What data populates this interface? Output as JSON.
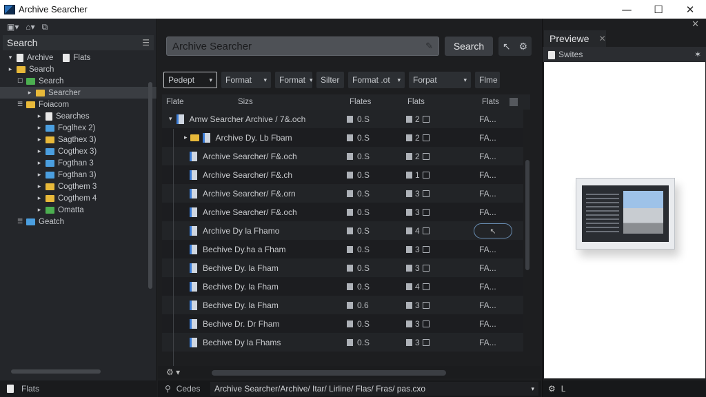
{
  "window": {
    "title": "Archive Searcher",
    "controls": {
      "minimize": "—",
      "maximize": "☐",
      "close": "✕"
    }
  },
  "sidebar": {
    "toolbar_icons": [
      "new-file-icon",
      "build-icon",
      "copy-icon"
    ],
    "search_label": "Search",
    "menu_glyph": "☰",
    "tree": [
      {
        "label": "Archive",
        "extra": "Flats",
        "indent": 0,
        "toggle": "▾",
        "icon": "doc"
      },
      {
        "label": "Search",
        "indent": 0,
        "toggle": "▸",
        "icon": "yellow"
      },
      {
        "label": "Search",
        "indent": 1,
        "toggle": "☐",
        "icon": "green"
      },
      {
        "label": "Searcher",
        "indent": 2,
        "toggle": "▸",
        "icon": "yellow",
        "selected": true
      },
      {
        "label": "Foiacom",
        "indent": 1,
        "toggle": "☰",
        "icon": "yellow"
      },
      {
        "label": "Searches",
        "indent": 3,
        "toggle": "▸",
        "icon": "doc"
      },
      {
        "label": "Foglhex 2)",
        "indent": 3,
        "toggle": "▸",
        "icon": "blue"
      },
      {
        "label": "Sagthex 3)",
        "indent": 3,
        "toggle": "▸",
        "icon": "yellow"
      },
      {
        "label": "Cogthex 3)",
        "indent": 3,
        "toggle": "▸",
        "icon": "blue"
      },
      {
        "label": "Fogthan 3",
        "indent": 3,
        "toggle": "▸",
        "icon": "blue"
      },
      {
        "label": "Fogthan 3)",
        "indent": 3,
        "toggle": "▸",
        "icon": "blue"
      },
      {
        "label": "Cogthem 3",
        "indent": 3,
        "toggle": "▸",
        "icon": "yellow"
      },
      {
        "label": "Cogthem 4",
        "indent": 3,
        "toggle": "▸",
        "icon": "yellow"
      },
      {
        "label": "Omatta",
        "indent": 3,
        "toggle": "▸",
        "icon": "green"
      },
      {
        "label": "Geatch",
        "indent": 1,
        "toggle": "☰",
        "icon": "blue"
      }
    ],
    "status": "Flats"
  },
  "main": {
    "search_value": "Archive Searcher",
    "search_button": "Search",
    "filters": [
      {
        "label": "Pedept",
        "caret": "▾"
      },
      {
        "label": "Format",
        "caret": "▾"
      },
      {
        "label": "Format",
        "caret": "▾"
      },
      {
        "label": "Silter",
        "caret": ""
      },
      {
        "label": "Format .ot",
        "caret": "▾"
      },
      {
        "label": "Forpat",
        "caret": "▾"
      },
      {
        "label": "Flme",
        "caret": ""
      }
    ],
    "columns": [
      "Flate",
      "Sizs",
      "Flates",
      "Flats",
      "Flats"
    ],
    "rows": [
      {
        "name": "Amw Searcher Archive / 7&.och",
        "size": "0.S",
        "flag": "2",
        "fl": "FA..."
      },
      {
        "name": "Archive Dy. Lb Fbam",
        "size": "0.S",
        "flag": "2",
        "fl": "FA..."
      },
      {
        "name": "Archive Searcher/ F&.och",
        "size": "0.S",
        "flag": "2",
        "fl": "FA..."
      },
      {
        "name": "Archive Searcher/ F&.ch",
        "size": "0.S",
        "flag": "1",
        "fl": "FA..."
      },
      {
        "name": "Archive Searcher/ F&.orn",
        "size": "0.S",
        "flag": "3",
        "fl": "FA..."
      },
      {
        "name": "Archive Searcher/ F&.och",
        "size": "0.S",
        "flag": "3",
        "fl": "FA..."
      },
      {
        "name": "Archive Dy la Fhamo",
        "size": "0.S",
        "flag": "4",
        "fl": ""
      },
      {
        "name": "Bechive Dy.ha a Fham",
        "size": "0.S",
        "flag": "3",
        "fl": "FA..."
      },
      {
        "name": "Bechive Dy. la Fham",
        "size": "0.S",
        "flag": "3",
        "fl": "FA..."
      },
      {
        "name": "Bechive Dy. la Fham",
        "size": "0.S",
        "flag": "4",
        "fl": "FA..."
      },
      {
        "name": "Bechive Dy. la Fham",
        "size": "0.6",
        "flag": "3",
        "fl": "FA..."
      },
      {
        "name": "Bechive Dr. Dr Fham",
        "size": "0.S",
        "flag": "3",
        "fl": "FA..."
      },
      {
        "name": "Bechive Dy la Fhams",
        "size": "0.S",
        "flag": "3",
        "fl": "FA..."
      }
    ],
    "path_label": "Cedes",
    "path_value": "Archive Searcher/Archive/ Itar/ Lirline/ Flas/ Fras/ pas.cxo"
  },
  "preview": {
    "tab_label": "Previewe",
    "sub_label": "Swites",
    "status": "L"
  },
  "colors": {
    "accent": "#3b7dd8",
    "folder": "#e8b93a"
  }
}
